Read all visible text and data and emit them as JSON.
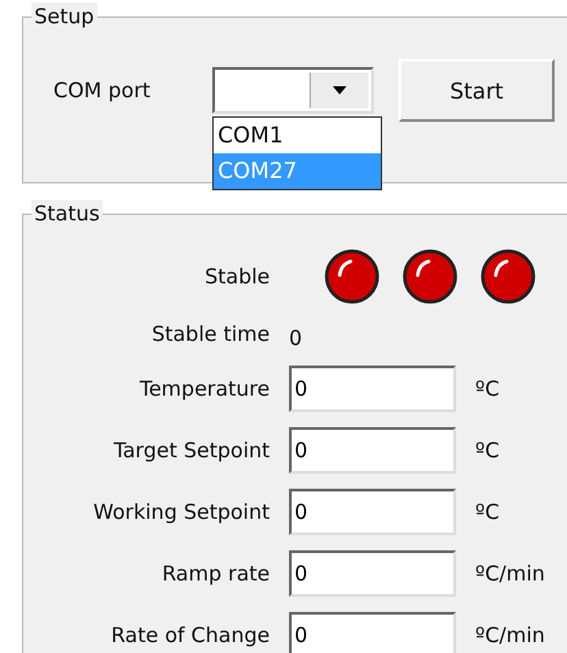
{
  "setup": {
    "title": "Setup",
    "com_port": {
      "label": "COM port",
      "options": [
        {
          "label": "COM1",
          "selected": false
        },
        {
          "label": "COM27",
          "selected": true
        }
      ]
    },
    "start_button": "Start"
  },
  "status": {
    "title": "Status",
    "stable": {
      "label": "Stable",
      "lamps": [
        {
          "on": true
        },
        {
          "on": true
        },
        {
          "on": true
        }
      ]
    },
    "stable_time": {
      "label": "Stable time",
      "value": "0"
    },
    "fields": [
      {
        "label": "Temperature",
        "value": "0",
        "unit": "ºC"
      },
      {
        "label": "Target Setpoint",
        "value": "0",
        "unit": "ºC"
      },
      {
        "label": "Working Setpoint",
        "value": "0",
        "unit": "ºC"
      },
      {
        "label": "Ramp rate",
        "value": "0",
        "unit": "ºC/min"
      },
      {
        "label": "Rate of Change",
        "value": "0",
        "unit": "ºC/min"
      }
    ]
  }
}
